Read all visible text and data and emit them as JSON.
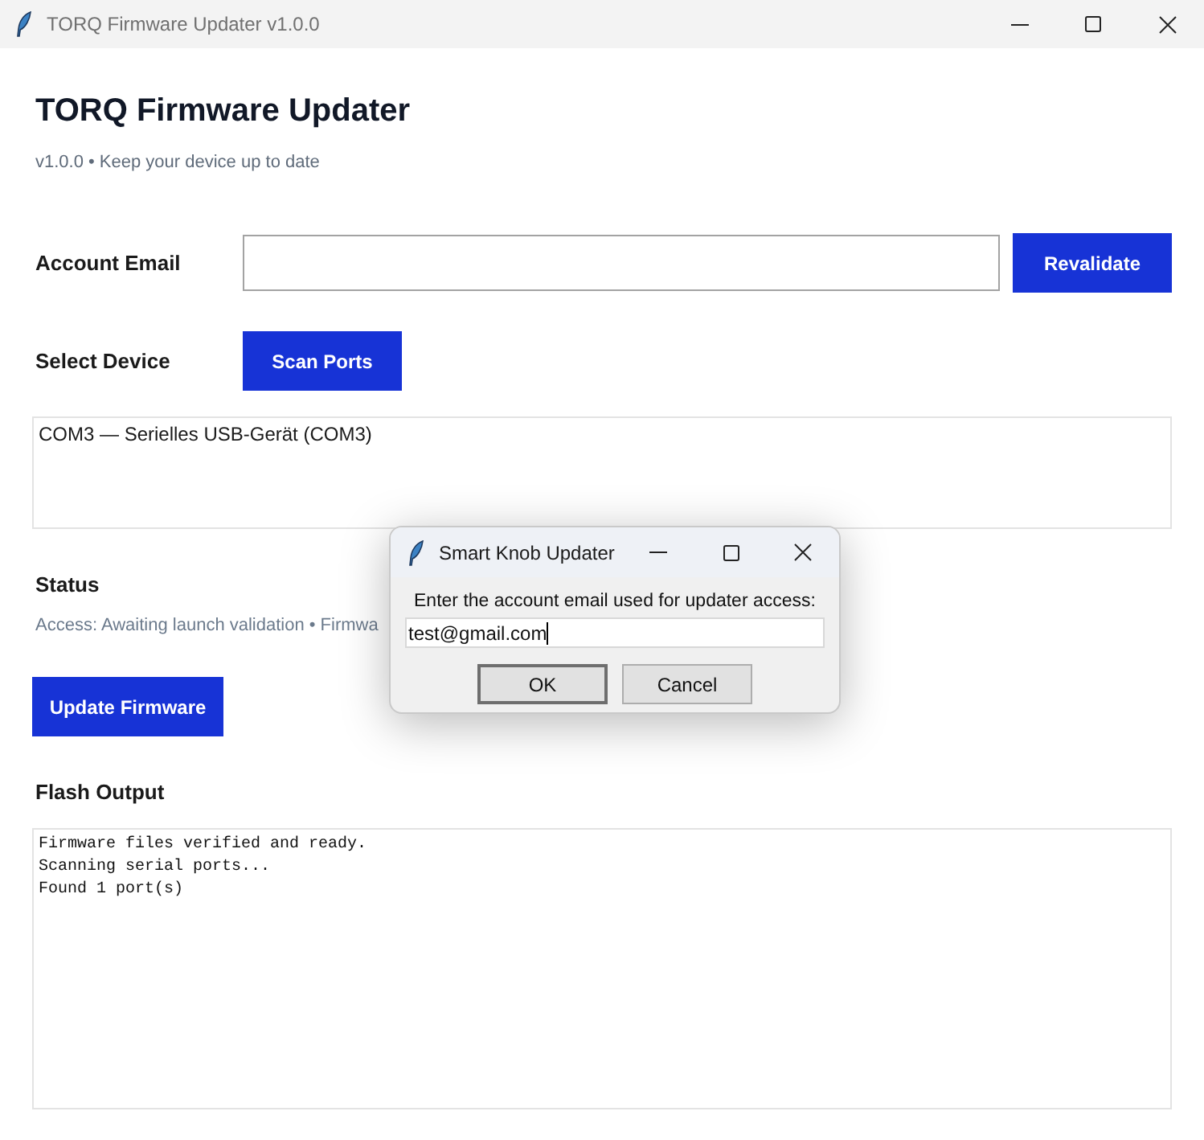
{
  "window": {
    "title": "TORQ Firmware Updater v1.0.0"
  },
  "header": {
    "title": "TORQ Firmware Updater",
    "subtitle": "v1.0.0 • Keep your device up to date"
  },
  "account": {
    "label": "Account Email",
    "button": "Revalidate"
  },
  "device": {
    "label": "Select Device",
    "button": "Scan Ports",
    "ports": [
      {
        "label": "COM3 — Serielles USB-Gerät (COM3)",
        "selected": false
      }
    ]
  },
  "status": {
    "label": "Status",
    "text": "Access: Awaiting launch validation • Firmwa"
  },
  "update_button": "Update Firmware",
  "flash_output": {
    "label": "Flash Output",
    "lines": [
      "Firmware files verified and ready.",
      "Scanning serial ports...",
      "Found 1 port(s)"
    ]
  },
  "dialog": {
    "title": "Smart Knob Updater",
    "prompt": "Enter the account email used for updater access:",
    "value": "test@gmail.com",
    "buttons": [
      {
        "label": "OK",
        "default": true
      },
      {
        "label": "Cancel",
        "default": false
      }
    ]
  }
}
